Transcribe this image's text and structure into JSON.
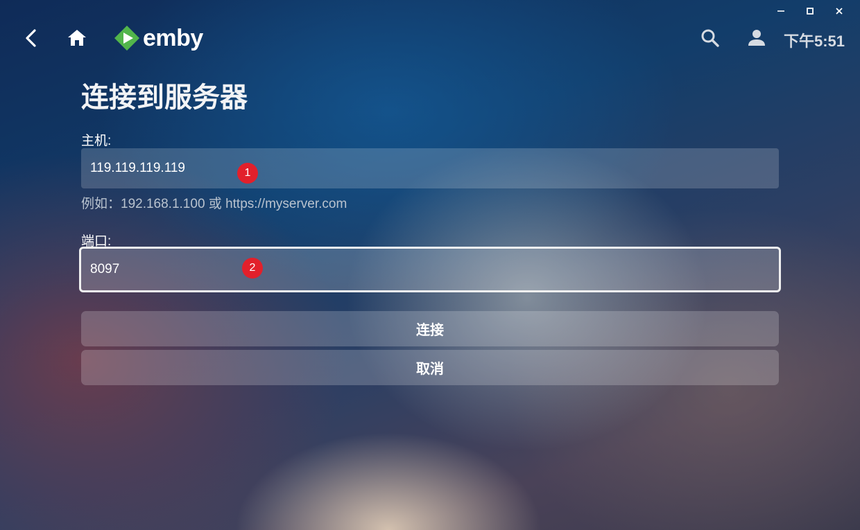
{
  "window": {
    "minimize_label": "–",
    "maximize_label": "□",
    "close_label": "×"
  },
  "header": {
    "logo_text": "emby",
    "clock": "下午5:51",
    "icons": [
      "back-icon",
      "home-icon",
      "emby-logo-icon",
      "search-icon",
      "user-icon"
    ]
  },
  "page": {
    "title": "连接到服务器"
  },
  "form": {
    "host_label": "主机:",
    "host_value": "119.119.119.119",
    "host_helper": "例如：192.168.1.100 或 https://myserver.com",
    "port_label": "端口:",
    "port_value": "8097"
  },
  "buttons": {
    "connect": "连接",
    "cancel": "取消"
  },
  "annotations": {
    "badge_1": "1",
    "badge_2": "2"
  },
  "colors": {
    "logo_green": "#52b54b",
    "badge_red": "#e2202b"
  }
}
